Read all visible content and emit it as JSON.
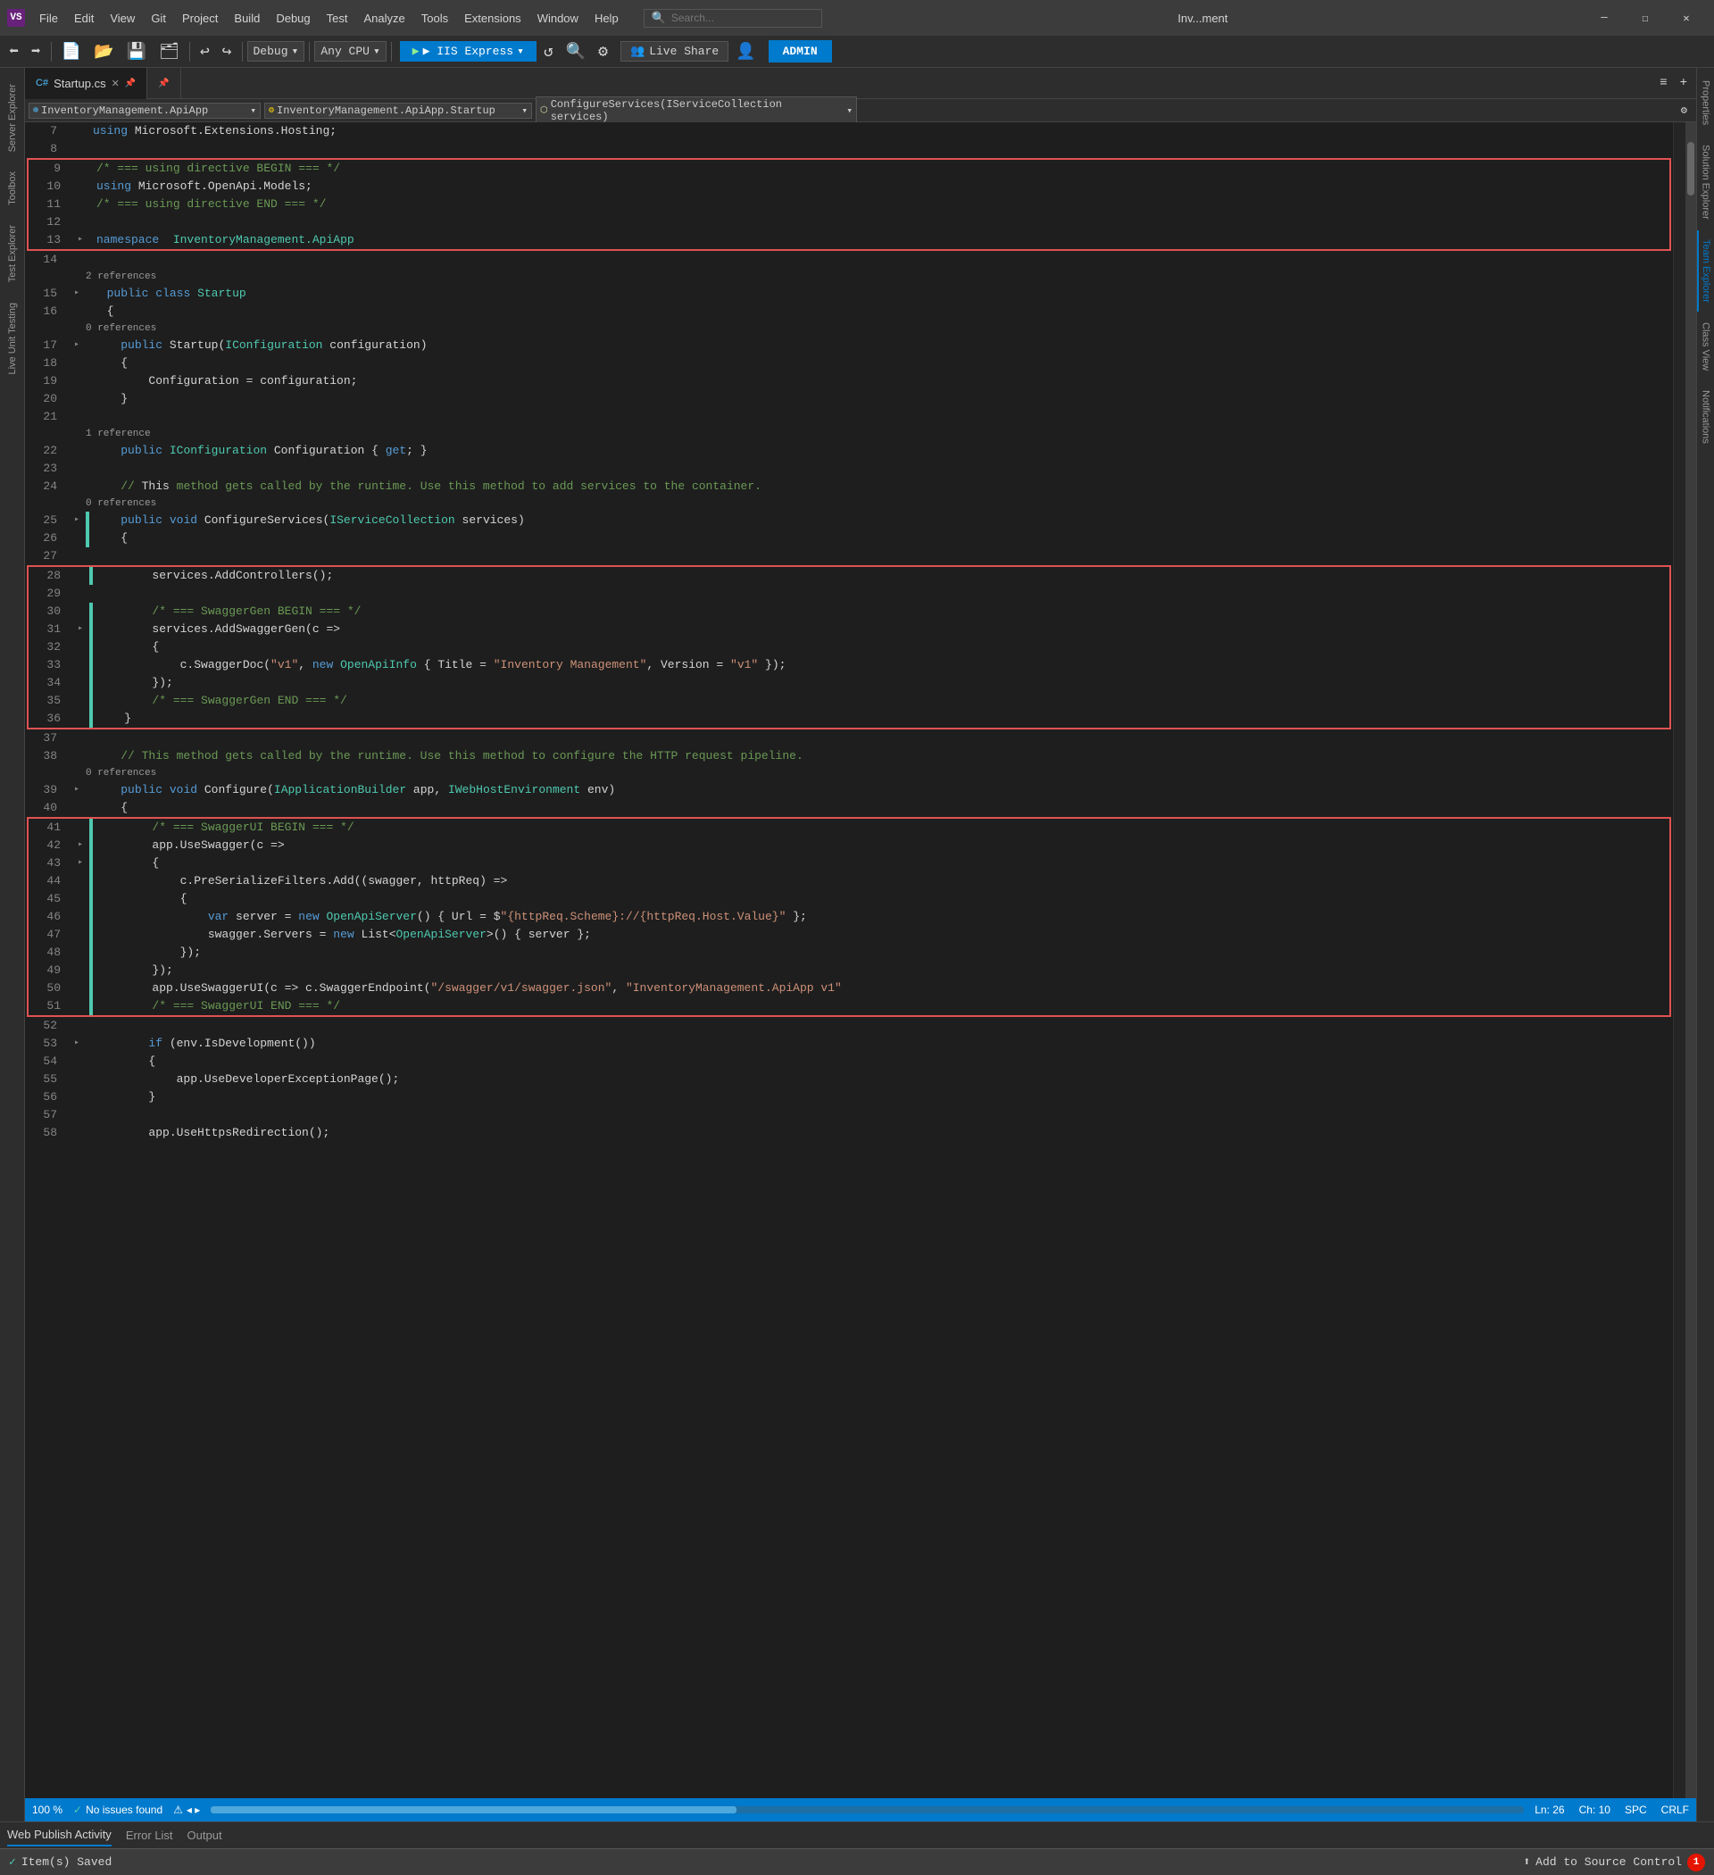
{
  "titlebar": {
    "icon": "VS",
    "menus": [
      "File",
      "Edit",
      "View",
      "Git",
      "Project",
      "Build",
      "Debug",
      "Test",
      "Analyze",
      "Tools",
      "Extensions",
      "Window",
      "Help"
    ],
    "search_placeholder": "Search...",
    "title": "Inv...ment",
    "controls": [
      "—",
      "☐",
      "✕"
    ]
  },
  "toolbar": {
    "run_label": "▶ IIS Express",
    "debug_label": "Debug",
    "cpu_label": "Any CPU",
    "live_share": "Live Share",
    "admin": "ADMIN"
  },
  "tabs": [
    {
      "label": "Startup.cs",
      "active": true,
      "pinned": false,
      "modified": false
    },
    {
      "label": "",
      "active": false,
      "pinned": true,
      "modified": false
    }
  ],
  "nav": {
    "namespace": "InventoryManagement.ApiApp",
    "class": "InventoryManagement.ApiApp.Startup",
    "method": "ConfigureServices(IServiceCollection services)"
  },
  "sidebar_left": [
    "Server Explorer",
    "Toolbox",
    "Test Explorer",
    "Live Unit Testing"
  ],
  "sidebar_right": [
    "Properties",
    "Solution Explorer",
    "Team Explorer",
    "Class View",
    "Notifications"
  ],
  "code": {
    "lines": [
      {
        "num": 7,
        "indent": 2,
        "text": "using Microsoft.Extensions.Hosting;"
      },
      {
        "num": 8,
        "indent": 0,
        "text": ""
      },
      {
        "num": 9,
        "indent": 2,
        "text": "/* === using directive BEGIN === */"
      },
      {
        "num": 10,
        "indent": 2,
        "text": "using Microsoft.OpenApi.Models;"
      },
      {
        "num": 11,
        "indent": 2,
        "text": "/* === using directive END === */"
      },
      {
        "num": 12,
        "indent": 0,
        "text": ""
      },
      {
        "num": 13,
        "indent": 1,
        "text": "namespace InventoryManagement.ApiApp"
      },
      {
        "num": 14,
        "indent": 0,
        "text": ""
      },
      {
        "num": 15,
        "indent": 1,
        "text": "public class Startup"
      },
      {
        "num": 16,
        "indent": 2,
        "text": "{"
      },
      {
        "num": 17,
        "indent": 2,
        "text": "public Startup(IConfiguration configuration)"
      },
      {
        "num": 18,
        "indent": 2,
        "text": "{"
      },
      {
        "num": 19,
        "indent": 3,
        "text": "Configuration = configuration;"
      },
      {
        "num": 20,
        "indent": 2,
        "text": "}"
      },
      {
        "num": 21,
        "indent": 0,
        "text": ""
      },
      {
        "num": 22,
        "indent": 2,
        "text": "public IConfiguration Configuration { get; }"
      },
      {
        "num": 23,
        "indent": 0,
        "text": ""
      },
      {
        "num": 24,
        "indent": 2,
        "text": "// This method gets called by the runtime. Use this method to add services to the container."
      },
      {
        "num": 25,
        "indent": 2,
        "text": "public void ConfigureServices(IServiceCollection services)"
      },
      {
        "num": 26,
        "indent": 2,
        "text": "{"
      },
      {
        "num": 27,
        "indent": 0,
        "text": ""
      },
      {
        "num": 28,
        "indent": 3,
        "text": "services.AddControllers();"
      },
      {
        "num": 29,
        "indent": 0,
        "text": ""
      },
      {
        "num": 30,
        "indent": 3,
        "text": "/* === SwaggerGen BEGIN === */"
      },
      {
        "num": 31,
        "indent": 3,
        "text": "services.AddSwaggerGen(c =>"
      },
      {
        "num": 32,
        "indent": 3,
        "text": "{"
      },
      {
        "num": 33,
        "indent": 4,
        "text": "c.SwaggerDoc(\"v1\", new OpenApiInfo { Title = \"Inventory Management\", Version = \"v1\" });"
      },
      {
        "num": 34,
        "indent": 3,
        "text": "});"
      },
      {
        "num": 35,
        "indent": 3,
        "text": "/* === SwaggerGen END === */"
      },
      {
        "num": 36,
        "indent": 2,
        "text": "}"
      },
      {
        "num": 37,
        "indent": 0,
        "text": ""
      },
      {
        "num": 38,
        "indent": 2,
        "text": "// This method gets called by the runtime. Use this method to configure the HTTP request pipeline."
      },
      {
        "num": 39,
        "indent": 2,
        "text": "public void Configure(IApplicationBuilder app, IWebHostEnvironment env)"
      },
      {
        "num": 40,
        "indent": 2,
        "text": "{"
      },
      {
        "num": 41,
        "indent": 3,
        "text": "/* === SwaggerUI BEGIN === */"
      },
      {
        "num": 42,
        "indent": 3,
        "text": "app.UseSwagger(c =>"
      },
      {
        "num": 43,
        "indent": 3,
        "text": "{"
      },
      {
        "num": 44,
        "indent": 4,
        "text": "c.PreSerializeFilters.Add((swagger, httpReq) =>"
      },
      {
        "num": 45,
        "indent": 4,
        "text": "{"
      },
      {
        "num": 46,
        "indent": 5,
        "text": "var server = new OpenApiServer() { Url = $\"{httpReq.Scheme}://{httpReq.Host.Value}\" };"
      },
      {
        "num": 47,
        "indent": 5,
        "text": "swagger.Servers = new List<OpenApiServer>() { server };"
      },
      {
        "num": 48,
        "indent": 4,
        "text": "});"
      },
      {
        "num": 49,
        "indent": 3,
        "text": "});"
      },
      {
        "num": 50,
        "indent": 3,
        "text": "app.UseSwaggerUI(c => c.SwaggerEndpoint(\"/swagger/v1/swagger.json\", \"InventoryManagement.ApiApp v1\""
      },
      {
        "num": 51,
        "indent": 3,
        "text": "/* === SwaggerUI END === */"
      },
      {
        "num": 52,
        "indent": 0,
        "text": ""
      },
      {
        "num": 53,
        "indent": 3,
        "text": "if (env.IsDevelopment())"
      },
      {
        "num": 54,
        "indent": 3,
        "text": "{"
      },
      {
        "num": 55,
        "indent": 4,
        "text": "app.UseDeveloperExceptionPage();"
      },
      {
        "num": 56,
        "indent": 3,
        "text": "}"
      },
      {
        "num": 57,
        "indent": 0,
        "text": ""
      },
      {
        "num": 58,
        "indent": 3,
        "text": "app.UseHttpsRedirection();"
      }
    ]
  },
  "status_bar": {
    "zoom": "100 %",
    "issues": "No issues found",
    "ln": "Ln: 26",
    "ch": "Ch: 10",
    "spc": "SPC",
    "crlf": "CRLF"
  },
  "panel_tabs": [
    "Web Publish Activity",
    "Error List",
    "Output"
  ],
  "bottom": {
    "saved": "Item(s) Saved",
    "source_control": "Add to Source Control",
    "notification_count": "1"
  }
}
